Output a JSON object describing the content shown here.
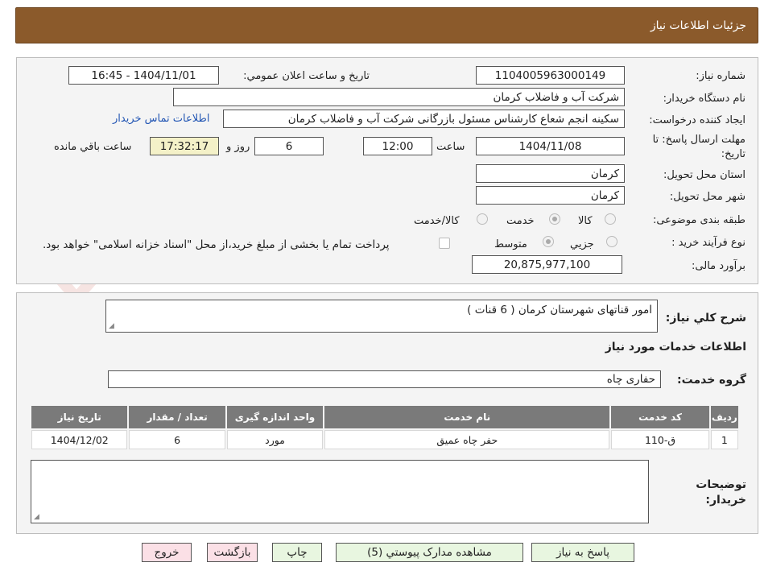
{
  "header": {
    "title": "جزئيات اطلاعات نياز"
  },
  "watermark": {
    "text": "AriaTender.net"
  },
  "form": {
    "need_number_label": "شماره نياز:",
    "need_number": "1104005963000149",
    "announce_label": "تاريخ و ساعت اعلان عمومي:",
    "announce_value": "1404/11/01 - 16:45",
    "buyer_org_label": "نام دستگاه خريدار:",
    "buyer_org": "شرکت آب و فاضلاب کرمان",
    "creator_label": "ايجاد کننده درخواست:",
    "creator": "سکينه انجم شعاع کارشناس مسئول بازرگانی شرکت آب و فاضلاب کرمان",
    "contact_link": "اطلاعات تماس خريدار",
    "deadline_label_1": "مهلت ارسال پاسخ: تا",
    "deadline_label_2": "تاريخ:",
    "deadline_date": "1404/11/08",
    "time_label": "ساعت",
    "deadline_time": "12:00",
    "days": "6",
    "days_label": "روز و",
    "remaining_time": "17:32:17",
    "remaining_label": "ساعت باقي مانده",
    "province_label": "استان محل تحويل:",
    "province": "کرمان",
    "city_label": "شهر محل تحويل:",
    "city": "کرمان",
    "category_label": "طبقه بندی موضوعی:",
    "category_options": [
      "کالا",
      "خدمت",
      "کالا/خدمت"
    ],
    "category_selected": "خدمت",
    "process_label": "نوع فرآيند خريد :",
    "process_options": [
      "جزيي",
      "متوسط"
    ],
    "process_selected": "متوسط",
    "payment_note": "پرداخت تمام يا بخشی از مبلغ خريد،از محل \"اسناد خزانه اسلامی\" خواهد بود.",
    "budget_label": "برآورد مالی:",
    "budget": "20,875,977,100"
  },
  "description": {
    "label": "شرح کلي نياز:",
    "value": "امور قناتهای شهرستان کرمان ( 6 قنات )"
  },
  "services": {
    "section_title": "اطلاعات خدمات مورد نياز",
    "group_label": "گروه خدمت:",
    "group_value": "حفاری چاه",
    "columns": [
      "رديف",
      "کد خدمت",
      "نام خدمت",
      "واحد اندازه گيری",
      "تعداد / مقدار",
      "تاريخ نياز"
    ],
    "rows": [
      [
        "1",
        "ق-110",
        "حفر چاه عميق",
        "مورد",
        "6",
        "1404/12/02"
      ]
    ]
  },
  "buyer_notes": {
    "label_1": "توضيحات",
    "label_2": "خريدار:",
    "value": ""
  },
  "buttons": {
    "reply": "پاسخ به نياز",
    "attachments": "مشاهده مدارک پيوستي (5)",
    "print": "چاپ",
    "back": "بازگشت",
    "exit": "خروج"
  }
}
